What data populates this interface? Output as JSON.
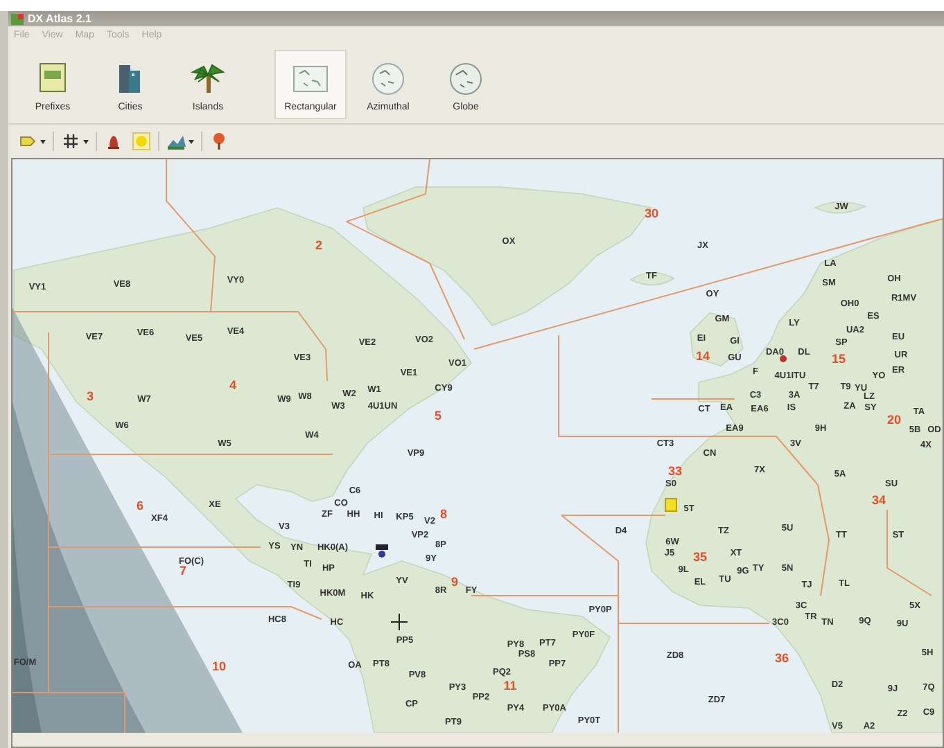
{
  "window": {
    "title": "DX Atlas 2.1"
  },
  "menu": [
    "File",
    "View",
    "Map",
    "Tools",
    "Help"
  ],
  "views": [
    {
      "label": "Prefixes",
      "kind": "prefixes",
      "selected": false
    },
    {
      "label": "Cities",
      "kind": "cities",
      "selected": false
    },
    {
      "label": "Islands",
      "kind": "islands",
      "selected": false
    },
    {
      "label": "Rectangular",
      "kind": "rectangular",
      "selected": true
    },
    {
      "label": "Azimuthal",
      "kind": "azimuthal",
      "selected": false
    },
    {
      "label": "Globe",
      "kind": "globe",
      "selected": false
    }
  ],
  "tools": [
    {
      "kind": "label",
      "dropdown": true
    },
    {
      "kind": "grid",
      "dropdown": true
    },
    {
      "kind": "bell",
      "dropdown": false
    },
    {
      "kind": "sun",
      "dropdown": false
    },
    {
      "kind": "layers",
      "dropdown": true
    },
    {
      "kind": "pin",
      "dropdown": false
    }
  ],
  "map": {
    "labels": [
      {
        "text": "2",
        "kind": "zone"
      },
      {
        "text": "30",
        "kind": "zone"
      },
      {
        "text": "14",
        "kind": "zone"
      },
      {
        "text": "15",
        "kind": "zone"
      },
      {
        "text": "20",
        "kind": "zone"
      },
      {
        "text": "3",
        "kind": "zone"
      },
      {
        "text": "4",
        "kind": "zone"
      },
      {
        "text": "5",
        "kind": "zone"
      },
      {
        "text": "6",
        "kind": "zone"
      },
      {
        "text": "7",
        "kind": "zone"
      },
      {
        "text": "8",
        "kind": "zone"
      },
      {
        "text": "9",
        "kind": "zone"
      },
      {
        "text": "10",
        "kind": "zone"
      },
      {
        "text": "11",
        "kind": "zone"
      },
      {
        "text": "33",
        "kind": "zone"
      },
      {
        "text": "34",
        "kind": "zone"
      },
      {
        "text": "35",
        "kind": "zone"
      },
      {
        "text": "36",
        "kind": "zone"
      },
      {
        "text": "VY1",
        "kind": "prefix"
      },
      {
        "text": "VE8",
        "kind": "prefix"
      },
      {
        "text": "VY0",
        "kind": "prefix"
      },
      {
        "text": "OX",
        "kind": "prefix"
      },
      {
        "text": "JX",
        "kind": "prefix"
      },
      {
        "text": "TF",
        "kind": "prefix"
      },
      {
        "text": "JW",
        "kind": "prefix"
      },
      {
        "text": "OY",
        "kind": "prefix"
      },
      {
        "text": "LA",
        "kind": "prefix"
      },
      {
        "text": "SM",
        "kind": "prefix"
      },
      {
        "text": "OH",
        "kind": "prefix"
      },
      {
        "text": "OH0",
        "kind": "prefix"
      },
      {
        "text": "R1MV",
        "kind": "prefix"
      },
      {
        "text": "ES",
        "kind": "prefix"
      },
      {
        "text": "GM",
        "kind": "prefix"
      },
      {
        "text": "LY",
        "kind": "prefix"
      },
      {
        "text": "UA2",
        "kind": "prefix"
      },
      {
        "text": "EI",
        "kind": "prefix"
      },
      {
        "text": "GI",
        "kind": "prefix"
      },
      {
        "text": "SP",
        "kind": "prefix"
      },
      {
        "text": "EU",
        "kind": "prefix"
      },
      {
        "text": "UR",
        "kind": "prefix"
      },
      {
        "text": "GU",
        "kind": "prefix"
      },
      {
        "text": "DA0",
        "kind": "prefix"
      },
      {
        "text": "DL",
        "kind": "prefix"
      },
      {
        "text": "F",
        "kind": "prefix"
      },
      {
        "text": "4U1ITU",
        "kind": "prefix"
      },
      {
        "text": "YO",
        "kind": "prefix"
      },
      {
        "text": "ER",
        "kind": "prefix"
      },
      {
        "text": "T7",
        "kind": "prefix"
      },
      {
        "text": "T9",
        "kind": "prefix"
      },
      {
        "text": "YU",
        "kind": "prefix"
      },
      {
        "text": "C3",
        "kind": "prefix"
      },
      {
        "text": "3A",
        "kind": "prefix"
      },
      {
        "text": "LZ",
        "kind": "prefix"
      },
      {
        "text": "CT",
        "kind": "prefix"
      },
      {
        "text": "EA",
        "kind": "prefix"
      },
      {
        "text": "EA6",
        "kind": "prefix"
      },
      {
        "text": "IS",
        "kind": "prefix"
      },
      {
        "text": "ZA",
        "kind": "prefix"
      },
      {
        "text": "SY",
        "kind": "prefix"
      },
      {
        "text": "TA",
        "kind": "prefix"
      },
      {
        "text": "EA9",
        "kind": "prefix"
      },
      {
        "text": "9H",
        "kind": "prefix"
      },
      {
        "text": "5B",
        "kind": "prefix"
      },
      {
        "text": "OD",
        "kind": "prefix"
      },
      {
        "text": "CT3",
        "kind": "prefix"
      },
      {
        "text": "3V",
        "kind": "prefix"
      },
      {
        "text": "4X",
        "kind": "prefix"
      },
      {
        "text": "CN",
        "kind": "prefix"
      },
      {
        "text": "7X",
        "kind": "prefix"
      },
      {
        "text": "5A",
        "kind": "prefix"
      },
      {
        "text": "S0",
        "kind": "prefix"
      },
      {
        "text": "SU",
        "kind": "prefix"
      },
      {
        "text": "5T",
        "kind": "prefix"
      },
      {
        "text": "D4",
        "kind": "prefix"
      },
      {
        "text": "TZ",
        "kind": "prefix"
      },
      {
        "text": "5U",
        "kind": "prefix"
      },
      {
        "text": "TT",
        "kind": "prefix"
      },
      {
        "text": "ST",
        "kind": "prefix"
      },
      {
        "text": "6W",
        "kind": "prefix"
      },
      {
        "text": "J5",
        "kind": "prefix"
      },
      {
        "text": "XT",
        "kind": "prefix"
      },
      {
        "text": "9L",
        "kind": "prefix"
      },
      {
        "text": "9G",
        "kind": "prefix"
      },
      {
        "text": "TY",
        "kind": "prefix"
      },
      {
        "text": "5N",
        "kind": "prefix"
      },
      {
        "text": "EL",
        "kind": "prefix"
      },
      {
        "text": "TU",
        "kind": "prefix"
      },
      {
        "text": "TJ",
        "kind": "prefix"
      },
      {
        "text": "TL",
        "kind": "prefix"
      },
      {
        "text": "3C",
        "kind": "prefix"
      },
      {
        "text": "5X",
        "kind": "prefix"
      },
      {
        "text": "3C0",
        "kind": "prefix"
      },
      {
        "text": "TR",
        "kind": "prefix"
      },
      {
        "text": "TN",
        "kind": "prefix"
      },
      {
        "text": "9Q",
        "kind": "prefix"
      },
      {
        "text": "9U",
        "kind": "prefix"
      },
      {
        "text": "ZD8",
        "kind": "prefix"
      },
      {
        "text": "5H",
        "kind": "prefix"
      },
      {
        "text": "D2",
        "kind": "prefix"
      },
      {
        "text": "9J",
        "kind": "prefix"
      },
      {
        "text": "7Q",
        "kind": "prefix"
      },
      {
        "text": "ZD7",
        "kind": "prefix"
      },
      {
        "text": "Z2",
        "kind": "prefix"
      },
      {
        "text": "C9",
        "kind": "prefix"
      },
      {
        "text": "V5",
        "kind": "prefix"
      },
      {
        "text": "A2",
        "kind": "prefix"
      },
      {
        "text": "PY0P",
        "kind": "prefix"
      },
      {
        "text": "PY0F",
        "kind": "prefix"
      },
      {
        "text": "PY8",
        "kind": "prefix"
      },
      {
        "text": "PT7",
        "kind": "prefix"
      },
      {
        "text": "PS8",
        "kind": "prefix"
      },
      {
        "text": "PP7",
        "kind": "prefix"
      },
      {
        "text": "PQ2",
        "kind": "prefix"
      },
      {
        "text": "PP2",
        "kind": "prefix"
      },
      {
        "text": "PY4",
        "kind": "prefix"
      },
      {
        "text": "PY0A",
        "kind": "prefix"
      },
      {
        "text": "PY0T",
        "kind": "prefix"
      },
      {
        "text": "VE7",
        "kind": "prefix"
      },
      {
        "text": "VE6",
        "kind": "prefix"
      },
      {
        "text": "VE5",
        "kind": "prefix"
      },
      {
        "text": "VE4",
        "kind": "prefix"
      },
      {
        "text": "VE3",
        "kind": "prefix"
      },
      {
        "text": "VE2",
        "kind": "prefix"
      },
      {
        "text": "VO2",
        "kind": "prefix"
      },
      {
        "text": "VE1",
        "kind": "prefix"
      },
      {
        "text": "VO1",
        "kind": "prefix"
      },
      {
        "text": "W7",
        "kind": "prefix"
      },
      {
        "text": "W9",
        "kind": "prefix"
      },
      {
        "text": "W8",
        "kind": "prefix"
      },
      {
        "text": "W2",
        "kind": "prefix"
      },
      {
        "text": "W1",
        "kind": "prefix"
      },
      {
        "text": "CY9",
        "kind": "prefix"
      },
      {
        "text": "W3",
        "kind": "prefix"
      },
      {
        "text": "4U1UN",
        "kind": "prefix"
      },
      {
        "text": "W6",
        "kind": "prefix"
      },
      {
        "text": "W5",
        "kind": "prefix"
      },
      {
        "text": "W4",
        "kind": "prefix"
      },
      {
        "text": "VP9",
        "kind": "prefix"
      },
      {
        "text": "XE",
        "kind": "prefix"
      },
      {
        "text": "XF4",
        "kind": "prefix"
      },
      {
        "text": "C6",
        "kind": "prefix"
      },
      {
        "text": "CO",
        "kind": "prefix"
      },
      {
        "text": "ZF",
        "kind": "prefix"
      },
      {
        "text": "HH",
        "kind": "prefix"
      },
      {
        "text": "HI",
        "kind": "prefix"
      },
      {
        "text": "KP5",
        "kind": "prefix"
      },
      {
        "text": "V2",
        "kind": "prefix"
      },
      {
        "text": "VP2",
        "kind": "prefix"
      },
      {
        "text": "8P",
        "kind": "prefix"
      },
      {
        "text": "9Y",
        "kind": "prefix"
      },
      {
        "text": "V3",
        "kind": "prefix"
      },
      {
        "text": "YS",
        "kind": "prefix"
      },
      {
        "text": "YN",
        "kind": "prefix"
      },
      {
        "text": "HK0(A)",
        "kind": "prefix"
      },
      {
        "text": "TI",
        "kind": "prefix"
      },
      {
        "text": "HP",
        "kind": "prefix"
      },
      {
        "text": "TI9",
        "kind": "prefix"
      },
      {
        "text": "HK0M",
        "kind": "prefix"
      },
      {
        "text": "HK",
        "kind": "prefix"
      },
      {
        "text": "YV",
        "kind": "prefix"
      },
      {
        "text": "8R",
        "kind": "prefix"
      },
      {
        "text": "FY",
        "kind": "prefix"
      },
      {
        "text": "HC8",
        "kind": "prefix"
      },
      {
        "text": "HC",
        "kind": "prefix"
      },
      {
        "text": "PP5",
        "kind": "prefix"
      },
      {
        "text": "FO(C)",
        "kind": "prefix"
      },
      {
        "text": "FO/M",
        "kind": "prefix"
      },
      {
        "text": "OA",
        "kind": "prefix"
      },
      {
        "text": "PT8",
        "kind": "prefix"
      },
      {
        "text": "PV8",
        "kind": "prefix"
      },
      {
        "text": "PY3",
        "kind": "prefix"
      },
      {
        "text": "CP",
        "kind": "prefix"
      },
      {
        "text": "PT9",
        "kind": "prefix"
      }
    ]
  }
}
